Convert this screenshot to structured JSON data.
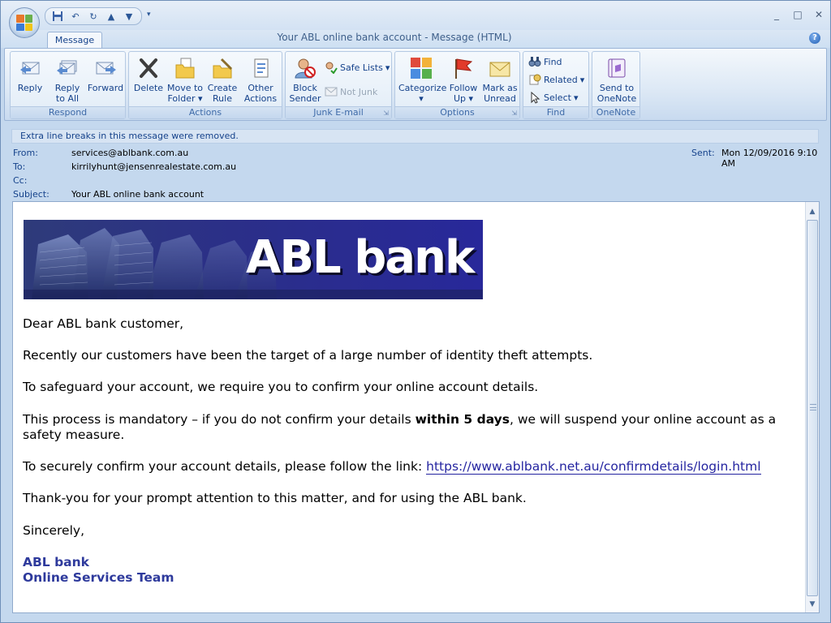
{
  "window": {
    "title": "Your ABL online bank account - Message (HTML)",
    "controls": [
      "_",
      "□",
      "✕"
    ]
  },
  "quick_access": [
    "save-icon",
    "undo-icon",
    "redo-icon",
    "previous-item-icon",
    "next-item-icon"
  ],
  "tabs": [
    {
      "label": "Message",
      "active": true
    }
  ],
  "ribbon": {
    "respond": {
      "label": "Respond",
      "reply": "Reply",
      "reply_all_1": "Reply",
      "reply_all_2": "to All",
      "forward": "Forward"
    },
    "actions": {
      "label": "Actions",
      "delete": "Delete",
      "move_1": "Move to",
      "move_2": "Folder",
      "create_1": "Create",
      "create_2": "Rule",
      "other_1": "Other",
      "other_2": "Actions"
    },
    "junk": {
      "label": "Junk E-mail",
      "block_1": "Block",
      "block_2": "Sender",
      "safe_lists": "Safe Lists",
      "not_junk": "Not Junk"
    },
    "options": {
      "label": "Options",
      "categorize": "Categorize",
      "follow_1": "Follow",
      "follow_2": "Up",
      "mark_1": "Mark as",
      "mark_2": "Unread"
    },
    "find": {
      "label": "Find",
      "find": "Find",
      "related": "Related",
      "select": "Select"
    },
    "onenote": {
      "label": "OneNote",
      "send_1": "Send to",
      "send_2": "OneNote"
    }
  },
  "header": {
    "info_bar": "Extra line breaks in this message were removed.",
    "from_label": "From:",
    "from": "services@ablbank.com.au",
    "to_label": "To:",
    "to": "kirrilyhunt@jensenrealestate.com.au",
    "cc_label": "Cc:",
    "cc": "",
    "subject_label": "Subject:",
    "subject": "Your ABL online bank account",
    "sent_label": "Sent:",
    "sent": "Mon 12/09/2016 9:10 AM"
  },
  "message": {
    "banner_text": "ABL bank",
    "greeting": "Dear ABL bank customer,",
    "p1": "Recently our customers have been the target of a large number of identity theft attempts.",
    "p2": "To safeguard your account, we require you to confirm your online account details.",
    "p3_a": "This process is mandatory – if you do not confirm your details ",
    "p3_bold": "within 5 days",
    "p3_b": ", we will suspend your online account as a",
    "p3_c": "safety measure.",
    "p4_a": "To securely confirm your account details, please follow the link: ",
    "link": "https://www.ablbank.net.au/confirmdetails/login.html",
    "p5": "Thank-you for your prompt attention to this matter, and for using the ABL bank.",
    "closing": "Sincerely,",
    "sig_1": "ABL bank",
    "sig_2": "Online Services Team"
  },
  "colors": {
    "ribbon_text": "#15428b",
    "signature": "#2e3a9c",
    "banner_bg": "#2b2f88"
  }
}
